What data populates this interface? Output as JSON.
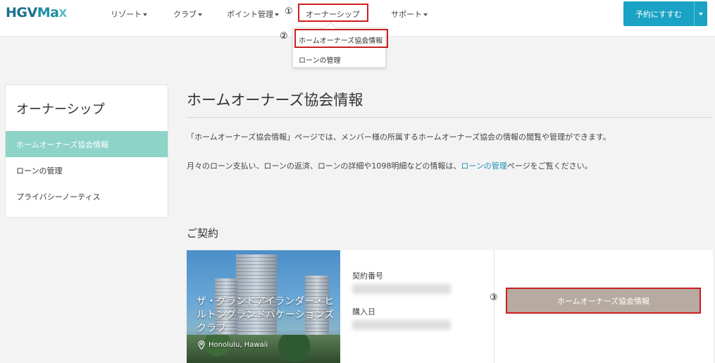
{
  "brand": {
    "logo_main": "HGV",
    "logo_max": "Ma",
    "logo_x": "X"
  },
  "nav": {
    "items": [
      {
        "label": "リゾート"
      },
      {
        "label": "クラブ"
      },
      {
        "label": "ポイント管理"
      },
      {
        "label": "オーナーシップ"
      },
      {
        "label": "サポート"
      }
    ],
    "reserve_button": "予約にすすむ"
  },
  "markers": {
    "one": "①",
    "two": "②",
    "three": "③"
  },
  "dropdown": {
    "items": [
      {
        "label": "ホームオーナーズ協会情報"
      },
      {
        "label": "ローンの管理"
      }
    ]
  },
  "sidebar": {
    "title": "オーナーシップ",
    "items": [
      {
        "label": "ホームオーナーズ協会情報",
        "active": true
      },
      {
        "label": "ローンの管理",
        "active": false
      },
      {
        "label": "プライバシーノーティス",
        "active": false
      }
    ]
  },
  "main": {
    "title": "ホームオーナーズ協会情報",
    "para1": "「ホームオーナーズ協会情報」ページでは、メンバー様の所属するホームオーナーズ協会の情報の閲覧や管理ができます。",
    "para2_before": "月々のローン支払い、ローンの返済、ローンの詳細や1098明細などの情報は、",
    "para2_link": "ローンの管理",
    "para2_after": "ページをご覧ください。",
    "section_title": "ご契約"
  },
  "contract": {
    "resort_name": "ザ・グランドアイランダー・ヒルトングランドバケーションズクラブ",
    "location": "Honolulu, Hawaii",
    "contract_number_label": "契約番号",
    "purchase_date_label": "購入日",
    "hoa_button": "ホームオーナーズ協会情報"
  },
  "colors": {
    "accent": "#1aa3c4",
    "sidebar_active": "#8dd3c7",
    "highlight_border": "#cc1f1f",
    "hoa_button": "#b7aaa0"
  }
}
